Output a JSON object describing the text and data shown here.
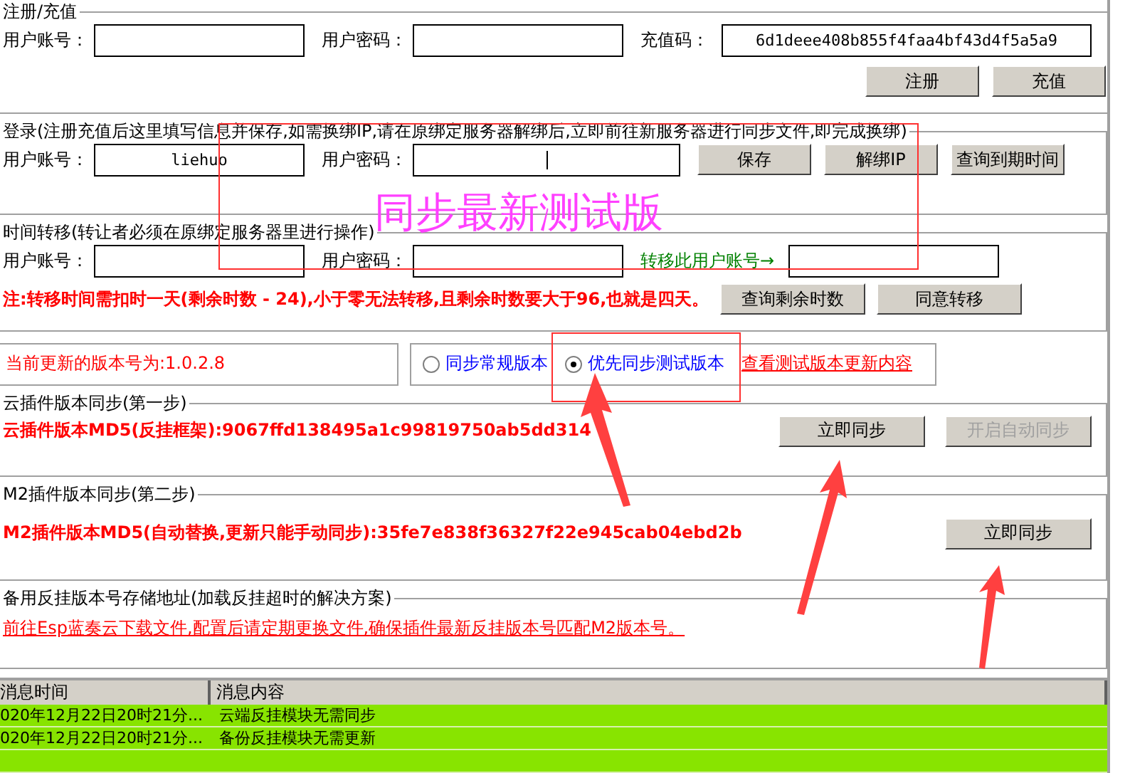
{
  "register": {
    "title": "注册/充值",
    "fields": [
      {
        "label": "用户账号："
      },
      {
        "label": "用户密码："
      },
      {
        "label": "充值码：",
        "value": "6d1deee408b855f4faa4bf43d4f5a5a9"
      }
    ],
    "buttons": [
      {
        "label": "注册",
        "disabled": false
      },
      {
        "label": "充值",
        "disabled": false
      }
    ]
  },
  "login": {
    "title": "登录(注册充值后这里填写信息并保存,如需换绑IP,请在原绑定服务器解绑后,立即前往新服务器进行同步文件,即完成换绑)",
    "fields": [
      {
        "label": "用户账号：",
        "value": "liehuo"
      },
      {
        "label": "用户密码：",
        "focused": true
      }
    ],
    "buttons": [
      {
        "label": "保存",
        "disabled": false
      },
      {
        "label": "解绑IP",
        "disabled": false
      },
      {
        "label": "查询到期时间",
        "disabled": false
      }
    ]
  },
  "transfer": {
    "title": "时间转移(转让者必须在原绑定服务器里进行操作)",
    "fields": [
      {
        "label": "用户账号："
      },
      {
        "label": "用户密码："
      },
      {
        "label": "转移此用户账号→"
      }
    ],
    "note": "注:转移时间需扣时一天(剩余时数 - 24),小于零无法转移,且剩余时数要大于96,也就是四天。",
    "buttons": [
      {
        "label": "查询剩余时数",
        "disabled": false
      },
      {
        "label": "同意转移",
        "disabled": false
      }
    ]
  },
  "version": {
    "current": "当前更新的版本号为:1.0.2.8",
    "radios": [
      {
        "label": "同步常规版本",
        "selected": false
      },
      {
        "label": "优先同步测试版本",
        "selected": true
      }
    ],
    "link": "查看测试版本更新内容"
  },
  "cloud_sync": {
    "title": "云插件版本同步(第一步)",
    "md5": "云插件版本MD5(反挂框架):9067ffd138495a1c99819750ab5dd314",
    "buttons": [
      {
        "label": "立即同步",
        "disabled": false
      },
      {
        "label": "开启自动同步",
        "disabled": true
      }
    ]
  },
  "m2_sync": {
    "title": "M2插件版本同步(第二步)",
    "md5": "M2插件版本MD5(自动替换,更新只能手动同步):35fe7e838f36327f22e945cab04ebd2b",
    "buttons": [
      {
        "label": "立即同步",
        "disabled": false
      }
    ]
  },
  "backup": {
    "title": "备用反挂版本号存储地址(加载反挂超时的解决方案)",
    "link": "前往Esp蓝奏云下载文件,配置后请定期更换文件,确保插件最新反挂版本号匹配M2版本号。"
  },
  "log": {
    "columns": [
      "消息时间",
      "消息内容"
    ],
    "rows": [
      {
        "time": "020年12月22日20时21分...",
        "message": "云端反挂模块无需同步"
      },
      {
        "time": "020年12月22日20时21分...",
        "message": "备份反挂模块无需更新"
      }
    ]
  },
  "annotation": {
    "text": "同步最新测试版"
  }
}
